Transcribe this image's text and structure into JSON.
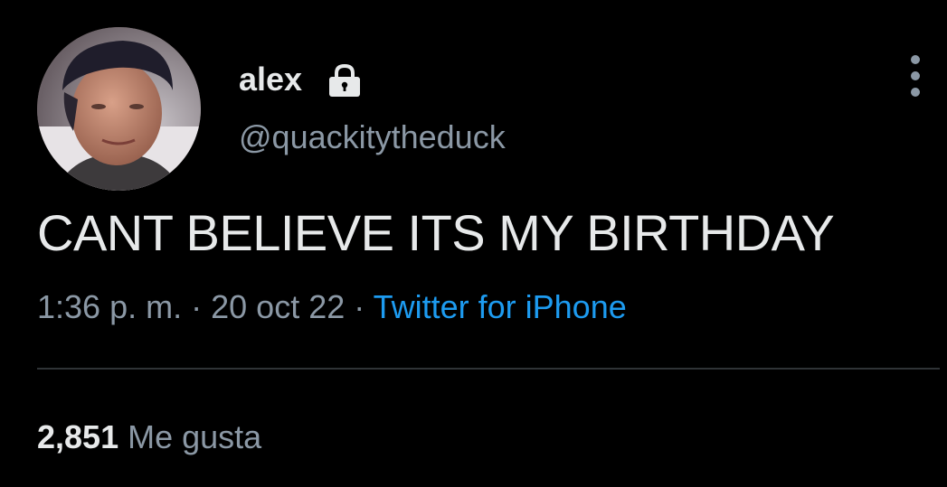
{
  "user": {
    "display_name": "alex",
    "handle": "@quackitytheduck",
    "protected_icon": "lock-icon",
    "avatar_icon": "profile-photo"
  },
  "tweet": {
    "text": "CANT BELIEVE ITS MY BIRTHDAY",
    "time": "1:36 p. m.",
    "separator": "·",
    "date": "20 oct 22",
    "source": "Twitter for iPhone"
  },
  "stats": {
    "likes_count": "2,851",
    "likes_label": "Me gusta"
  },
  "menu": {
    "icon": "more-vertical-icon"
  },
  "colors": {
    "background": "#000000",
    "text_primary": "#e7e9ea",
    "text_secondary": "#8b98a5",
    "link": "#1d9bf0",
    "divider": "#2f3336"
  }
}
